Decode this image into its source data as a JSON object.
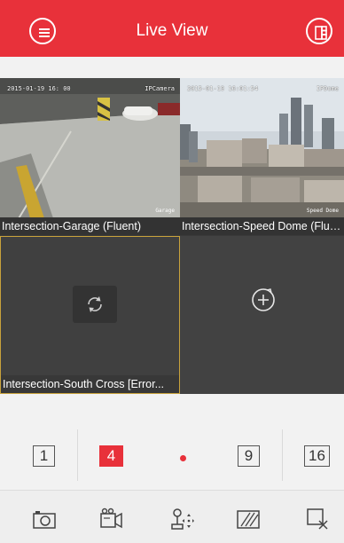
{
  "header": {
    "title": "Live View",
    "menu_icon": "menu-icon",
    "layout_icon": "window-layout-icon",
    "background_color": "#e8313a"
  },
  "cameras": [
    {
      "label": "Intersection-Garage (Fluent)",
      "osd_time": "2015-01-19 16:  00",
      "osd_name": "IPCamera",
      "overlay": "Garage"
    },
    {
      "label": "Intersection-Speed Dome (Flue...",
      "osd_time": "2015-01-19 16:01:54",
      "osd_name": "IPDome",
      "overlay": "Speed Dome"
    },
    {
      "label": "Intersection-South Cross [Error...",
      "state": "refresh",
      "icon": "refresh-icon"
    },
    {
      "label": "",
      "state": "empty",
      "icon": "add-camera-icon"
    }
  ],
  "split_options": [
    {
      "label": "1",
      "selected": false
    },
    {
      "label": "4",
      "selected": true
    },
    {
      "label": "9",
      "selected": false
    },
    {
      "label": "16",
      "selected": false
    }
  ],
  "toolbar": [
    {
      "name": "capture",
      "icon": "camera-icon"
    },
    {
      "name": "record",
      "icon": "video-record-icon"
    },
    {
      "name": "ptz",
      "icon": "ptz-joystick-icon"
    },
    {
      "name": "quality",
      "icon": "image-quality-icon"
    },
    {
      "name": "stop-all",
      "icon": "close-window-icon"
    }
  ],
  "colors": {
    "accent": "#e8313a",
    "selected_border": "#c8a23c"
  }
}
